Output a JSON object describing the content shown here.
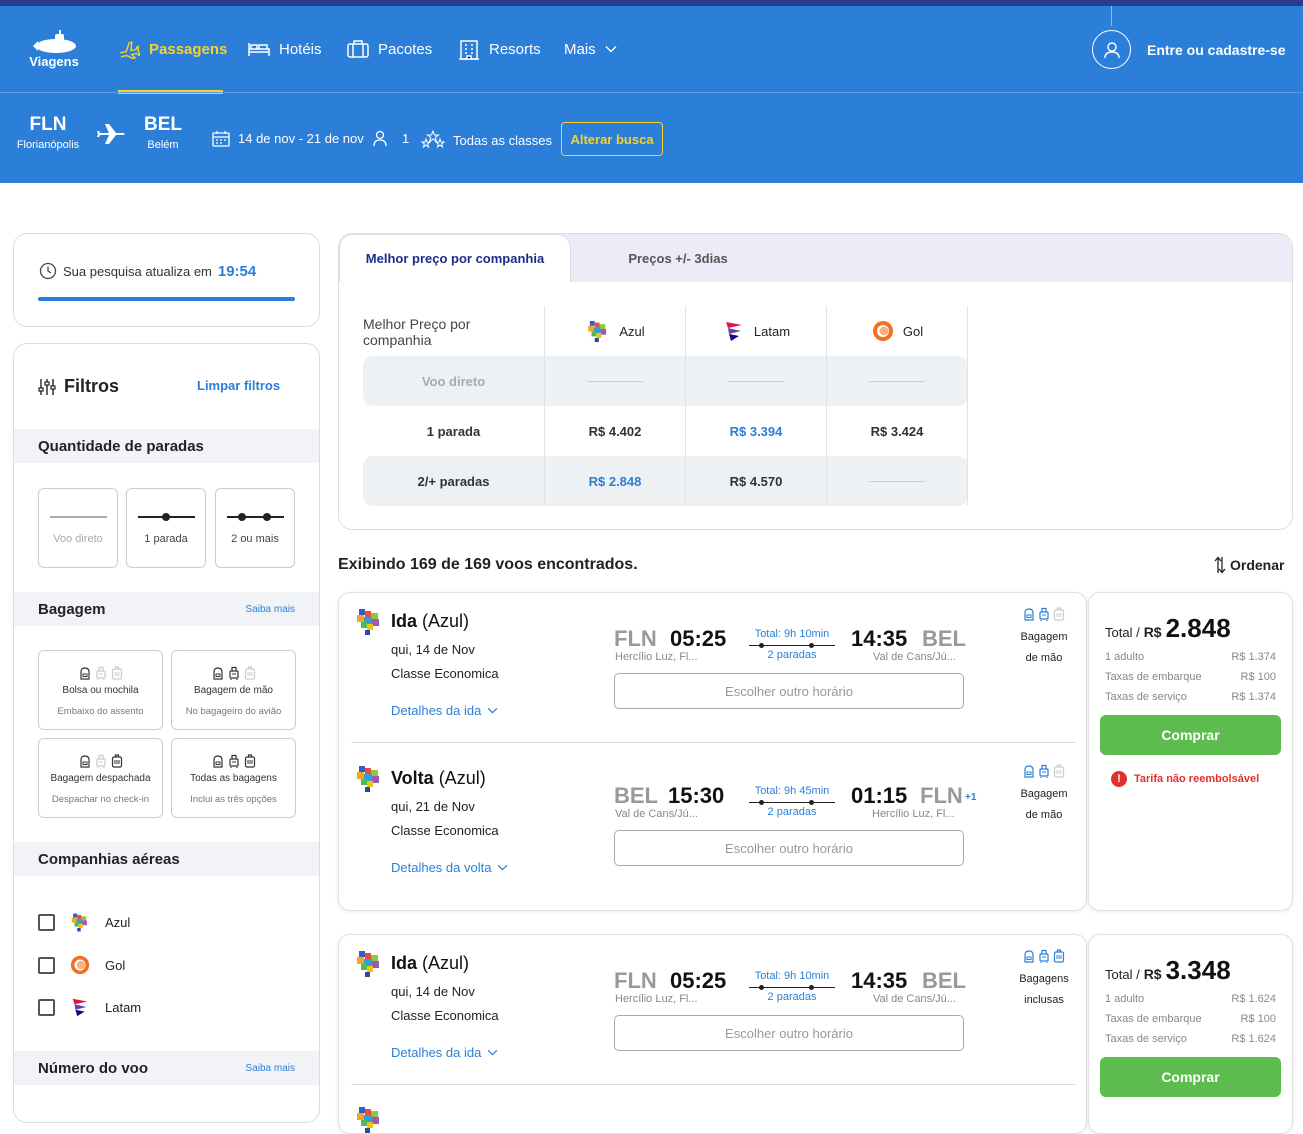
{
  "brand": {
    "name": "Viagens"
  },
  "nav": {
    "items": [
      {
        "label": "Passagens",
        "icon": "plane-icon",
        "active": true
      },
      {
        "label": "Hotéis",
        "icon": "bed-icon"
      },
      {
        "label": "Pacotes",
        "icon": "suitcase-icon"
      },
      {
        "label": "Resorts",
        "icon": "building-icon"
      },
      {
        "label": "Mais",
        "icon": "chevron-down-icon"
      }
    ],
    "login_label": "Entre ou cadastre-se"
  },
  "search": {
    "origin_code": "FLN",
    "origin_city": "Florianópolis",
    "destination_code": "BEL",
    "destination_city": "Belém",
    "dates": "14 de nov - 21 de nov",
    "passengers": "1",
    "cabin": "Todas as classes",
    "alter_label": "Alterar busca"
  },
  "timer": {
    "label": "Sua pesquisa atualiza em",
    "value": "19:54"
  },
  "filters": {
    "title": "Filtros",
    "clear_label": "Limpar filtros",
    "stops_title": "Quantidade de paradas",
    "stops": [
      "Voo direto",
      "1 parada",
      "2 ou mais"
    ],
    "baggage_title": "Bagagem",
    "baggage_more": "Saiba mais",
    "baggage_options": [
      {
        "title": "Bolsa ou mochila",
        "subtitle": "Embaixo do assento"
      },
      {
        "title": "Bagagem de mão",
        "subtitle": "No bagageiro do avião"
      },
      {
        "title": "Bagagem despachada",
        "subtitle": "Despachar no check-in"
      },
      {
        "title": "Todas as bagagens",
        "subtitle": "Inclui as três opções"
      }
    ],
    "airlines_title": "Companhias aéreas",
    "airlines": [
      "Azul",
      "Gol",
      "Latam"
    ],
    "flight_number_title": "Número do voo",
    "flight_number_more": "Saiba mais"
  },
  "best_price": {
    "tabs": [
      "Melhor preço por companhia",
      "Preços +/- 3dias"
    ],
    "corner_label": "Melhor Preço por companhia",
    "airlines": [
      "Azul",
      "Latam",
      "Gol"
    ],
    "rows": [
      {
        "label": "Voo direto",
        "values": [
          "",
          "",
          ""
        ]
      },
      {
        "label": "1 parada",
        "values": [
          "R$ 4.402",
          "R$ 3.394",
          "R$ 3.424"
        ]
      },
      {
        "label": "2/+ paradas",
        "values": [
          "R$ 2.848",
          "R$ 4.570",
          ""
        ]
      }
    ]
  },
  "results": {
    "summary": "Exibindo 169 de 169 voos encontrados.",
    "sort_label": "Ordenar"
  },
  "offers": [
    {
      "legs": [
        {
          "direction": "Ida",
          "airline": "(Azul)",
          "date": "qui, 14 de Nov",
          "cabin": "Classe Economica",
          "from_code": "FLN",
          "dep_time": "05:25",
          "from_name": "Hercílio Luz, Fl...",
          "duration": "Total: 9h 10min",
          "stops": "2 paradas",
          "arr_time": "14:35",
          "to_code": "BEL",
          "to_name": "Val de Cans/Jú...",
          "day_offset": "",
          "other_time": "Escolher outro horário",
          "details": "Detalhes da ida",
          "baggage_line1": "Bagagem",
          "baggage_line2": "de mão"
        },
        {
          "direction": "Volta",
          "airline": "(Azul)",
          "date": "qui, 21 de Nov",
          "cabin": "Classe Economica",
          "from_code": "BEL",
          "dep_time": "15:30",
          "from_name": "Val de Cans/Jú...",
          "duration": "Total: 9h 45min",
          "stops": "2 paradas",
          "arr_time": "01:15",
          "to_code": "FLN",
          "to_name": "Hercílio Luz, Fl...",
          "day_offset": "+1",
          "other_time": "Escolher outro horário",
          "details": "Detalhes da volta",
          "baggage_line1": "Bagagem",
          "baggage_line2": "de mão"
        }
      ],
      "total_label": "Total /",
      "currency": "R$",
      "total": "2.848",
      "breakdown": [
        {
          "label": "1 adulto",
          "value": "R$ 1.374"
        },
        {
          "label": "Taxas de embarque",
          "value": "R$ 100"
        },
        {
          "label": "Taxas de serviço",
          "value": "R$ 1.374"
        }
      ],
      "buy_label": "Comprar",
      "warning": "Tarifa não reembolsável"
    },
    {
      "legs": [
        {
          "direction": "Ida",
          "airline": "(Azul)",
          "date": "qui, 14 de Nov",
          "cabin": "Classe Economica",
          "from_code": "FLN",
          "dep_time": "05:25",
          "from_name": "Hercílio Luz, Fl...",
          "duration": "Total: 9h 10min",
          "stops": "2 paradas",
          "arr_time": "14:35",
          "to_code": "BEL",
          "to_name": "Val de Cans/Jú...",
          "day_offset": "",
          "other_time": "Escolher outro horário",
          "details": "Detalhes da ida",
          "baggage_line1": "Bagagens",
          "baggage_line2": "inclusas"
        }
      ],
      "total_label": "Total /",
      "currency": "R$",
      "total": "3.348",
      "breakdown": [
        {
          "label": "1 adulto",
          "value": "R$ 1.624"
        },
        {
          "label": "Taxas de embarque",
          "value": "R$ 100"
        },
        {
          "label": "Taxas de serviço",
          "value": "R$ 1.624"
        }
      ],
      "buy_label": "Comprar"
    }
  ],
  "colors": {
    "primary": "#2b7fd9",
    "accent": "#f8d22a",
    "buy": "#5cbc4e",
    "warning": "#e0302f",
    "dark_strip": "#2d3a8c"
  }
}
